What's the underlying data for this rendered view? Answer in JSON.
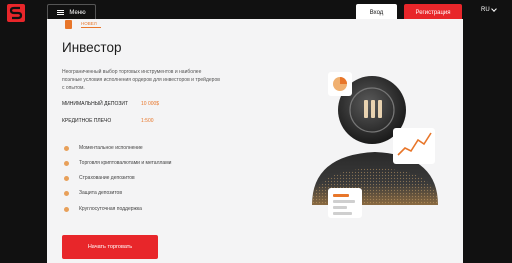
{
  "header": {
    "menu_label": "Меню",
    "login_label": "Вход",
    "register_label": "Регистрация",
    "language": "RU"
  },
  "prev_item_label": "НОВЕЛ",
  "main": {
    "title": "Инвестор",
    "description": "Неограниченный выбор торговых инструментов и наиболее поэлные условия исполнения ордеров для инвесторов и трейдеров с опытом.",
    "stats": [
      {
        "label": "МИНИМАЛЬНЫЙ ДЕПОЗИТ",
        "value": "10 000$"
      },
      {
        "label": "КРЕДИТНОЕ ПЛЕЧО",
        "value": "1:500"
      }
    ],
    "features": [
      "Моментальное исполнение",
      "Торговля криптовалютами и металлами",
      "Страхование депозитов",
      "Защита депозитов",
      "Круглосуточная поддержка"
    ],
    "cta_label": "Начать торговать"
  },
  "colors": {
    "accent": "#e8262a",
    "orange": "#e8762a",
    "dark": "#111111"
  },
  "icons": {
    "logo": "brand-s-logo-icon",
    "menu": "hamburger-icon",
    "lang": "chevron-down-icon"
  }
}
